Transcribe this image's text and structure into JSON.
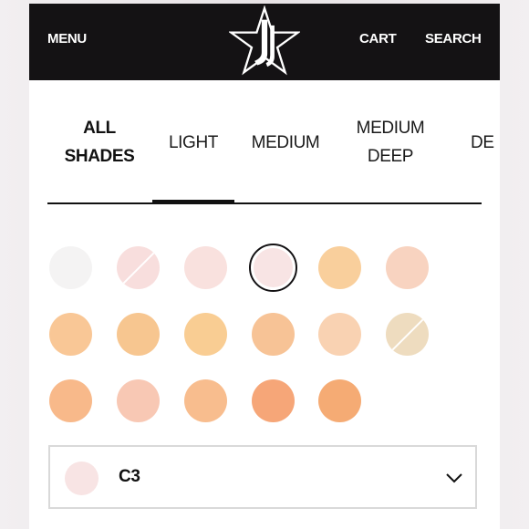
{
  "header": {
    "menu_label": "MENU",
    "cart_label": "CART",
    "search_label": "SEARCH",
    "logo_icon": "star-logo-icon",
    "background": "#141214"
  },
  "tabs": [
    {
      "line1": "ALL",
      "line2": "SHADES",
      "active": false
    },
    {
      "line1": "LIGHT",
      "line2": "",
      "active": true
    },
    {
      "line1": "MEDIUM",
      "line2": "",
      "active": false
    },
    {
      "line1": "MEDIUM",
      "line2": "DEEP",
      "active": false
    },
    {
      "line1": "DE",
      "line2": "",
      "active": false
    }
  ],
  "swatches": [
    [
      {
        "color": "#f4f3f3",
        "selected": false,
        "unavailable": false
      },
      {
        "color": "#f8dedd",
        "selected": false,
        "unavailable": true
      },
      {
        "color": "#f9e1de",
        "selected": false,
        "unavailable": false
      },
      {
        "color": "#f8e4e4",
        "selected": true,
        "unavailable": false
      },
      {
        "color": "#f9cf9c",
        "selected": false,
        "unavailable": false
      },
      {
        "color": "#f8d3c0",
        "selected": false,
        "unavailable": false
      }
    ],
    [
      {
        "color": "#f9c796",
        "selected": false,
        "unavailable": false
      },
      {
        "color": "#f7c690",
        "selected": false,
        "unavailable": false
      },
      {
        "color": "#f9cd93",
        "selected": false,
        "unavailable": false
      },
      {
        "color": "#f7c396",
        "selected": false,
        "unavailable": false
      },
      {
        "color": "#f9d2b2",
        "selected": false,
        "unavailable": false
      },
      {
        "color": "#eedcbf",
        "selected": false,
        "unavailable": true
      }
    ],
    [
      {
        "color": "#f8b98a",
        "selected": false,
        "unavailable": false
      },
      {
        "color": "#f8c8b4",
        "selected": false,
        "unavailable": false
      },
      {
        "color": "#f8bd8e",
        "selected": false,
        "unavailable": false
      },
      {
        "color": "#f6a678",
        "selected": false,
        "unavailable": false
      },
      {
        "color": "#f5ab74",
        "selected": false,
        "unavailable": false
      }
    ]
  ],
  "selected_shade": {
    "label": "C3",
    "color": "#f8e4e4",
    "dropdown_icon": "chevron-down-icon"
  }
}
